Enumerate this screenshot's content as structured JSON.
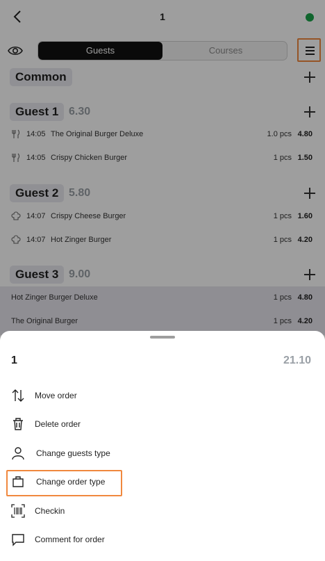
{
  "header": {
    "order_number": "1",
    "status_color": "#1aa44a"
  },
  "toolbar": {
    "tab_guests": "Guests",
    "tab_courses": "Courses"
  },
  "sections": {
    "common": {
      "title": "Common"
    },
    "guest1": {
      "title": "Guest 1",
      "total": "6.30",
      "items": [
        {
          "icon": "fork-knife-icon",
          "time": "14:05",
          "name": "The Original Burger Deluxe",
          "qty": "1.0 pcs",
          "price": "4.80"
        },
        {
          "icon": "fork-knife-icon",
          "time": "14:05",
          "name": "Crispy Chicken Burger",
          "qty": "1 pcs",
          "price": "1.50"
        }
      ]
    },
    "guest2": {
      "title": "Guest 2",
      "total": "5.80",
      "items": [
        {
          "icon": "chef-hat-icon",
          "time": "14:07",
          "name": "Crispy Cheese Burger",
          "qty": "1 pcs",
          "price": "1.60"
        },
        {
          "icon": "chef-hat-icon",
          "time": "14:07",
          "name": "Hot Zinger Burger",
          "qty": "1 pcs",
          "price": "4.20"
        }
      ]
    },
    "guest3": {
      "title": "Guest 3",
      "total": "9.00",
      "items": [
        {
          "name": "Hot Zinger Burger Deluxe",
          "qty": "1 pcs",
          "price": "4.80"
        },
        {
          "name": "The Original Burger",
          "qty": "1 pcs",
          "price": "4.20"
        }
      ]
    }
  },
  "sheet": {
    "order_number": "1",
    "total": "21.10",
    "actions": [
      {
        "icon": "move-arrows-icon",
        "label": "Move order"
      },
      {
        "icon": "trash-icon",
        "label": "Delete order"
      },
      {
        "icon": "person-icon",
        "label": "Change guests type"
      },
      {
        "icon": "bag-icon",
        "label": "Change order type"
      },
      {
        "icon": "barcode-icon",
        "label": "Checkin"
      },
      {
        "icon": "comment-icon",
        "label": "Comment for order"
      }
    ]
  },
  "colors": {
    "accent_highlight": "#f0883e",
    "active_tab": "#111111",
    "muted_total": "#9aa0a6"
  }
}
